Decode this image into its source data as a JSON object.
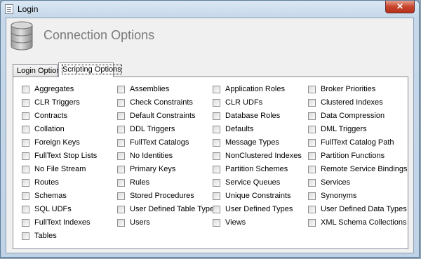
{
  "window": {
    "title": "Login",
    "close_glyph": "✕"
  },
  "header": {
    "title": "Connection Options",
    "icon": "database-icon"
  },
  "tabs": [
    {
      "label": "Login Options",
      "selected": false
    },
    {
      "label": "Scripting Options",
      "selected": true
    }
  ],
  "options": {
    "col1": [
      "Aggregates",
      "CLR Triggers",
      "Contracts",
      "Collation",
      "Foreign Keys",
      "FullText Stop Lists",
      "No File Stream",
      "Routes",
      "Schemas",
      "SQL UDFs",
      "FullText Indexes",
      "Tables"
    ],
    "col2": [
      "Assemblies",
      "Check Constraints",
      "Default Constraints",
      "DDL Triggers",
      "FullText Catalogs",
      "No Identities",
      "Primary Keys",
      "Rules",
      "Stored Procedures",
      "User Defined Table Types",
      "Users"
    ],
    "col3": [
      "Application Roles",
      "CLR UDFs",
      "Database Roles",
      "Defaults",
      "Message Types",
      "NonClustered Indexes",
      "Partition Schemes",
      "Service Queues",
      "Unique Constraints",
      "User Defined Types",
      "Views"
    ],
    "col4": [
      "Broker Priorities",
      "Clustered Indexes",
      "Data Compression",
      "DML Triggers",
      "FullText Catalog Path",
      "Partition Functions",
      "Remote Service Bindings",
      "Services",
      "Synonyms",
      "User Defined Data Types",
      "XML Schema Collections"
    ]
  }
}
